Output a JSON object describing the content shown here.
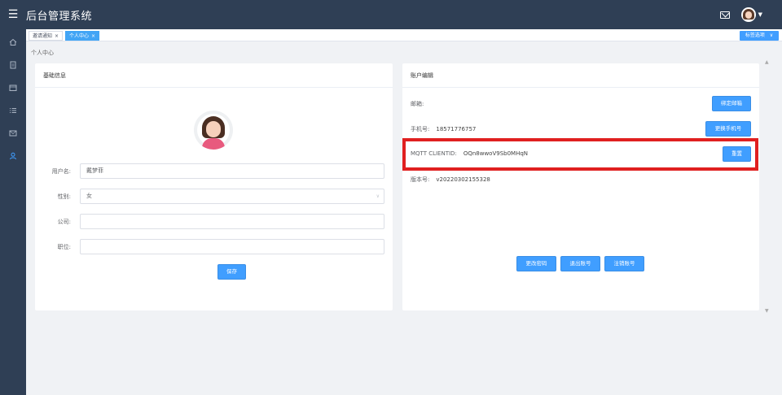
{
  "app": {
    "title": "后台管理系统"
  },
  "tabs": [
    {
      "label": "邀请通知",
      "close": "×"
    },
    {
      "label": "个人中心",
      "close": "×"
    }
  ],
  "tab_options": {
    "label": "标签选项",
    "caret": "∨"
  },
  "breadcrumb": "个人中心",
  "basic_card": {
    "title": "基础信息",
    "fields": {
      "username": {
        "label": "用户名:",
        "value": "戴梦菲"
      },
      "gender": {
        "label": "性别:",
        "value": "女"
      },
      "company": {
        "label": "公司:",
        "value": ""
      },
      "position": {
        "label": "职位:",
        "value": ""
      }
    },
    "save_label": "保存"
  },
  "account_card": {
    "title": "账户编辑",
    "email": {
      "label": "邮箱:",
      "value": "",
      "button": "绑定邮箱"
    },
    "phone": {
      "label": "手机号:",
      "value": "18571776757",
      "button": "更换手机号"
    },
    "mqtt": {
      "label": "MQTT CLIENTID:",
      "value": "OQn8wwoV9Sb0MHqN",
      "button": "重置"
    },
    "version": {
      "label": "版本号:",
      "value": "v20220302155328"
    },
    "actions": [
      "更改密码",
      "退出账号",
      "注销账号"
    ]
  },
  "icons": {
    "menu": "hamburger-icon",
    "mail": "mail-icon",
    "sidebar": [
      "home-icon",
      "document-icon",
      "folder-icon",
      "list-icon",
      "message-icon",
      "user-icon"
    ]
  },
  "colors": {
    "primary": "#409eff",
    "header": "#2f3f55",
    "highlight": "#e02020"
  }
}
